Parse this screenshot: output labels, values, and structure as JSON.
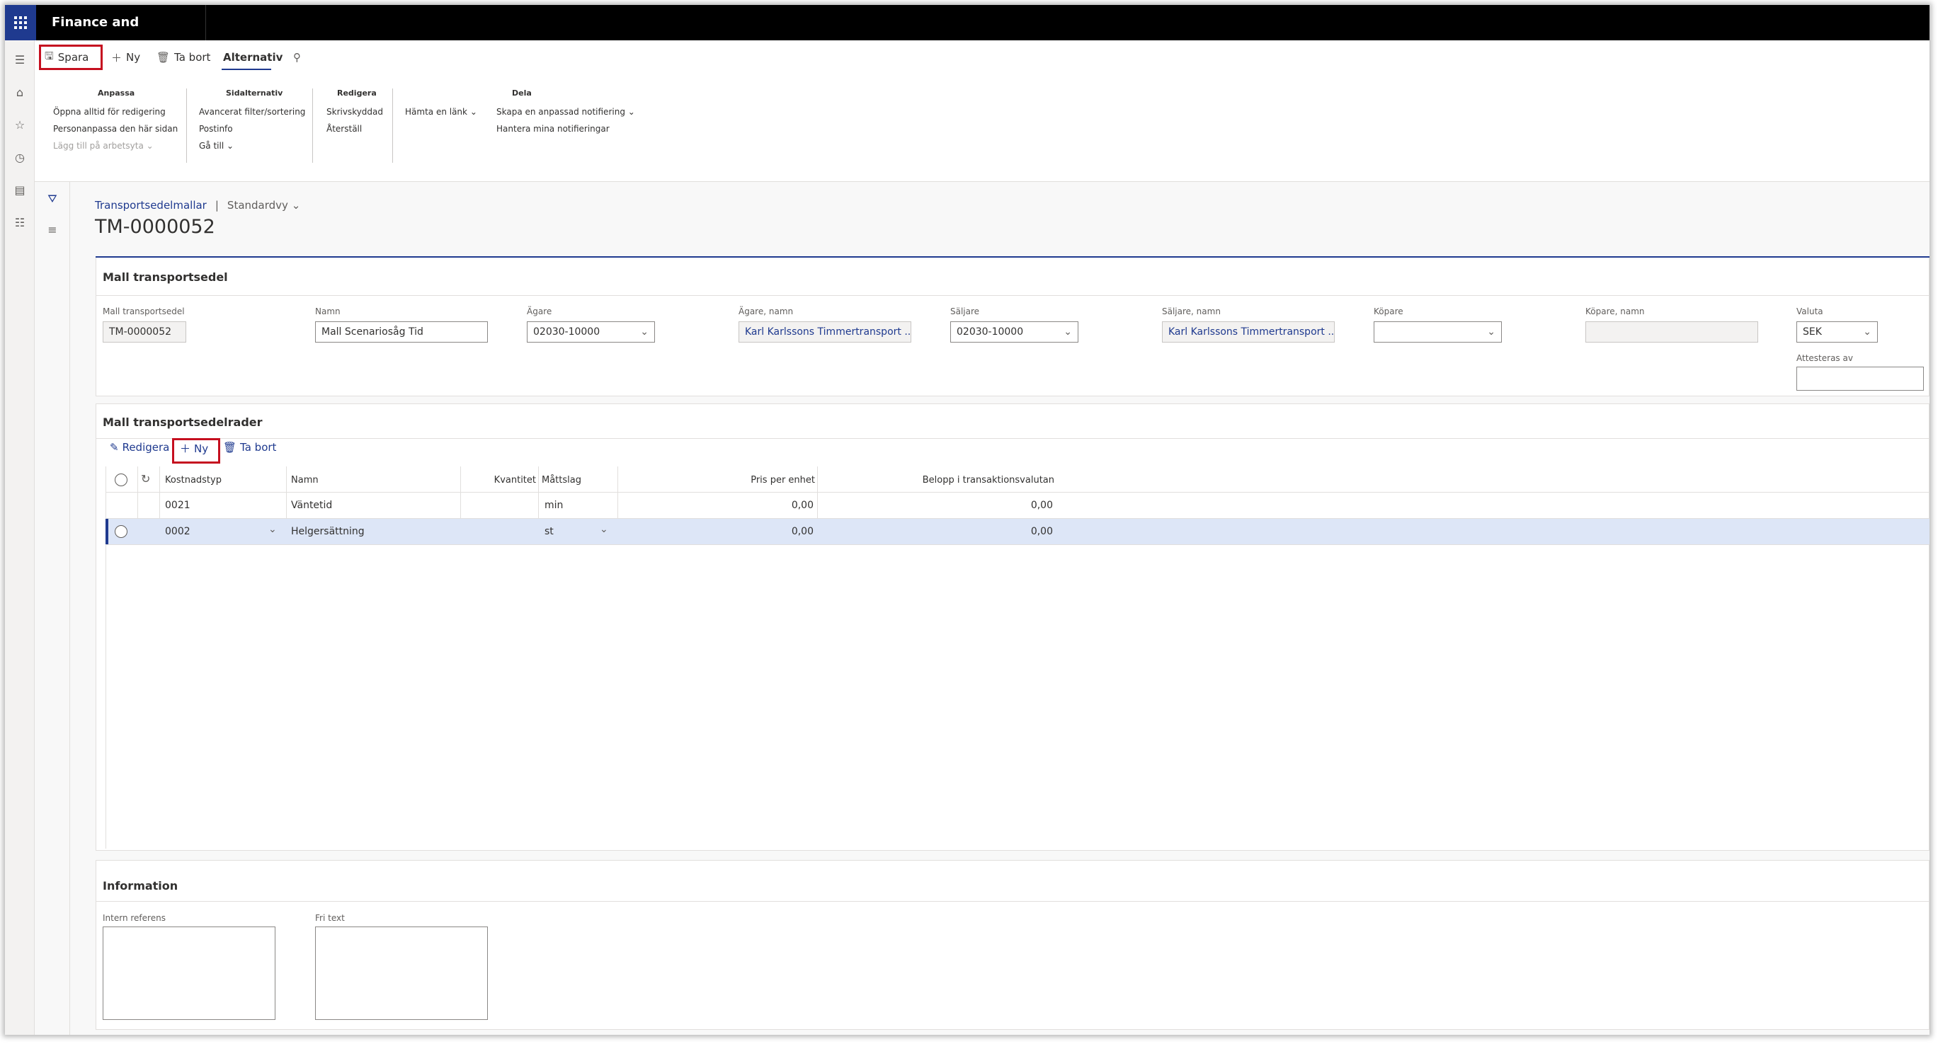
{
  "app": {
    "title": "Finance and Operations"
  },
  "action_pane": {
    "save": "Spara",
    "new": "Ny",
    "delete": "Ta bort",
    "options_tab": "Alternativ"
  },
  "ribbon": {
    "groups": [
      {
        "title": "Anpassa",
        "items": [
          "Öppna alltid för redigering",
          "Personanpassa den här sidan",
          "Lägg till på arbetsyta"
        ]
      },
      {
        "title": "Sidalternativ",
        "items": [
          "Avancerat filter/sortering",
          "Postinfo",
          "Gå till"
        ]
      },
      {
        "title": "Redigera",
        "items": [
          "Skrivskyddad",
          "Återställ"
        ]
      },
      {
        "title": "",
        "items": [
          "Hämta en länk"
        ]
      },
      {
        "title": "Dela",
        "items": [
          "Skapa en anpassad notifiering",
          "Hantera mina notifieringar"
        ]
      }
    ]
  },
  "breadcrumb": {
    "link": "Transportsedelmallar",
    "separator": "|",
    "view": "Standardvy"
  },
  "page_title": "TM-0000052",
  "header_section": {
    "title": "Mall transportsedel",
    "fields": [
      {
        "label": "Mall transportsedel",
        "value": "TM-0000052"
      },
      {
        "label": "Namn",
        "value": "Mall Scenariosåg Tid"
      },
      {
        "label": "Ägare",
        "value": "02030-10000"
      },
      {
        "label": "Ägare, namn",
        "value": "Karl Karlssons Timmertransport ..."
      },
      {
        "label": "Säljare",
        "value": "02030-10000"
      },
      {
        "label": "Säljare, namn",
        "value": "Karl Karlssons Timmertransport ..."
      },
      {
        "label": "Köpare",
        "value": ""
      },
      {
        "label": "Köpare, namn",
        "value": ""
      },
      {
        "label": "Valuta",
        "value": "SEK"
      },
      {
        "label": "Attesteras av",
        "value": ""
      }
    ]
  },
  "lines_section": {
    "title": "Mall transportsedelrader",
    "actions": {
      "edit": "Redigera",
      "new": "Ny",
      "delete": "Ta bort"
    },
    "columns": [
      "Kostnadstyp",
      "Namn",
      "Kvantitet",
      "Måttslag",
      "Pris per enhet",
      "Belopp i transaktionsvalutan"
    ],
    "rows": [
      {
        "cost_type": "0021",
        "name": "Väntetid",
        "quantity": "",
        "unit": "min",
        "price": "0,00",
        "amount": "0,00"
      },
      {
        "cost_type": "0002",
        "name": "Helgersättning",
        "quantity": "",
        "unit": "st",
        "price": "0,00",
        "amount": "0,00"
      }
    ]
  },
  "info_section": {
    "title": "Information",
    "fields": [
      {
        "label": "Intern referens",
        "value": ""
      },
      {
        "label": "Fri text",
        "value": ""
      }
    ]
  },
  "colors": {
    "brand": "#1f3a8f",
    "highlight": "#c50f1f",
    "selected_row": "#dde6f7"
  }
}
